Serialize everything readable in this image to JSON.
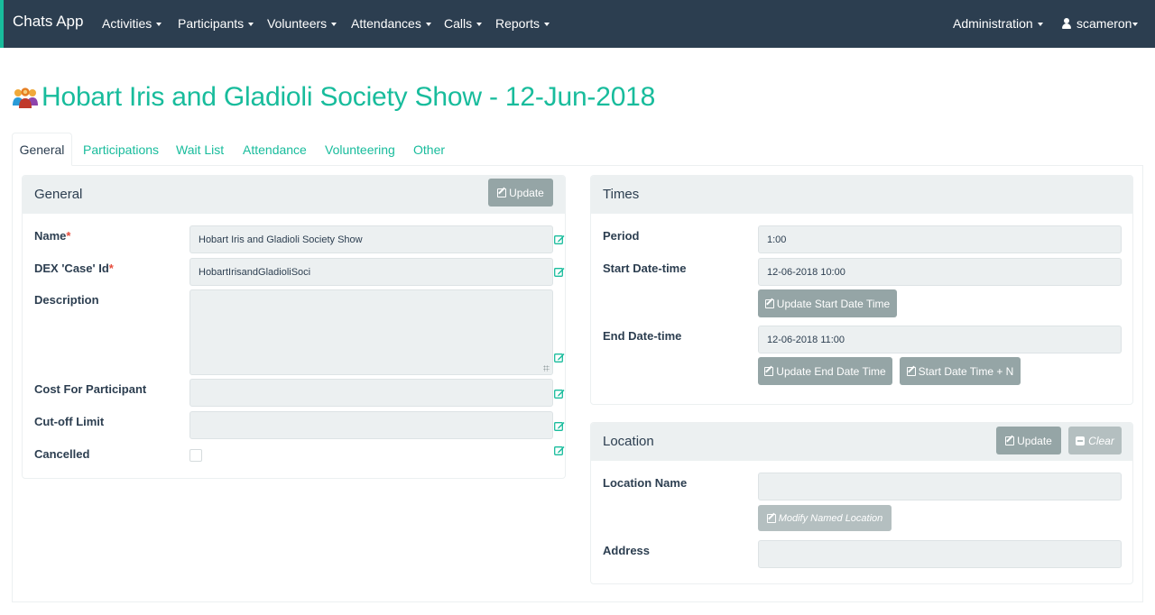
{
  "app": {
    "brand": "Chats App"
  },
  "nav": {
    "items": [
      "Activities",
      "Participants",
      "Volunteers",
      "Attendances",
      "Calls",
      "Reports"
    ],
    "admin": "Administration",
    "user": "scameron"
  },
  "page": {
    "title": "Hobart Iris and Gladioli Society Show - 12-Jun-2018"
  },
  "tabs": [
    "General",
    "Participations",
    "Wait List",
    "Attendance",
    "Volunteering",
    "Other"
  ],
  "general": {
    "title": "General",
    "update_label": "Update",
    "fields": {
      "name": {
        "label": "Name",
        "value": "Hobart Iris and Gladioli Society Show",
        "required": "*"
      },
      "dex": {
        "label": "DEX 'Case' Id",
        "value": "HobartIrisandGladioliSoci",
        "required": "*"
      },
      "description": {
        "label": "Description",
        "value": ""
      },
      "cost": {
        "label": "Cost For Participant",
        "value": ""
      },
      "cutoff": {
        "label": "Cut-off Limit",
        "value": ""
      },
      "cancelled": {
        "label": "Cancelled",
        "checked": false
      }
    }
  },
  "times": {
    "title": "Times",
    "period": {
      "label": "Period",
      "value": "1:00"
    },
    "start": {
      "label": "Start Date-time",
      "value": "12-06-2018 10:00",
      "button": "Update Start Date Time"
    },
    "end": {
      "label": "End Date-time",
      "value": "12-06-2018 11:00",
      "button": "Update End Date Time",
      "button2": "Start Date Time + N"
    }
  },
  "location": {
    "title": "Location",
    "update_label": "Update",
    "clear_label": "Clear",
    "name": {
      "label": "Location Name",
      "value": "",
      "button": "Modify Named Location"
    },
    "address": {
      "label": "Address",
      "value": ""
    }
  },
  "colors": {
    "navbar": "#2c3e50",
    "accent": "#18bc9c",
    "panel_head": "#ecf0f1",
    "button": "#95a5a6",
    "required": "#e74c3c"
  }
}
